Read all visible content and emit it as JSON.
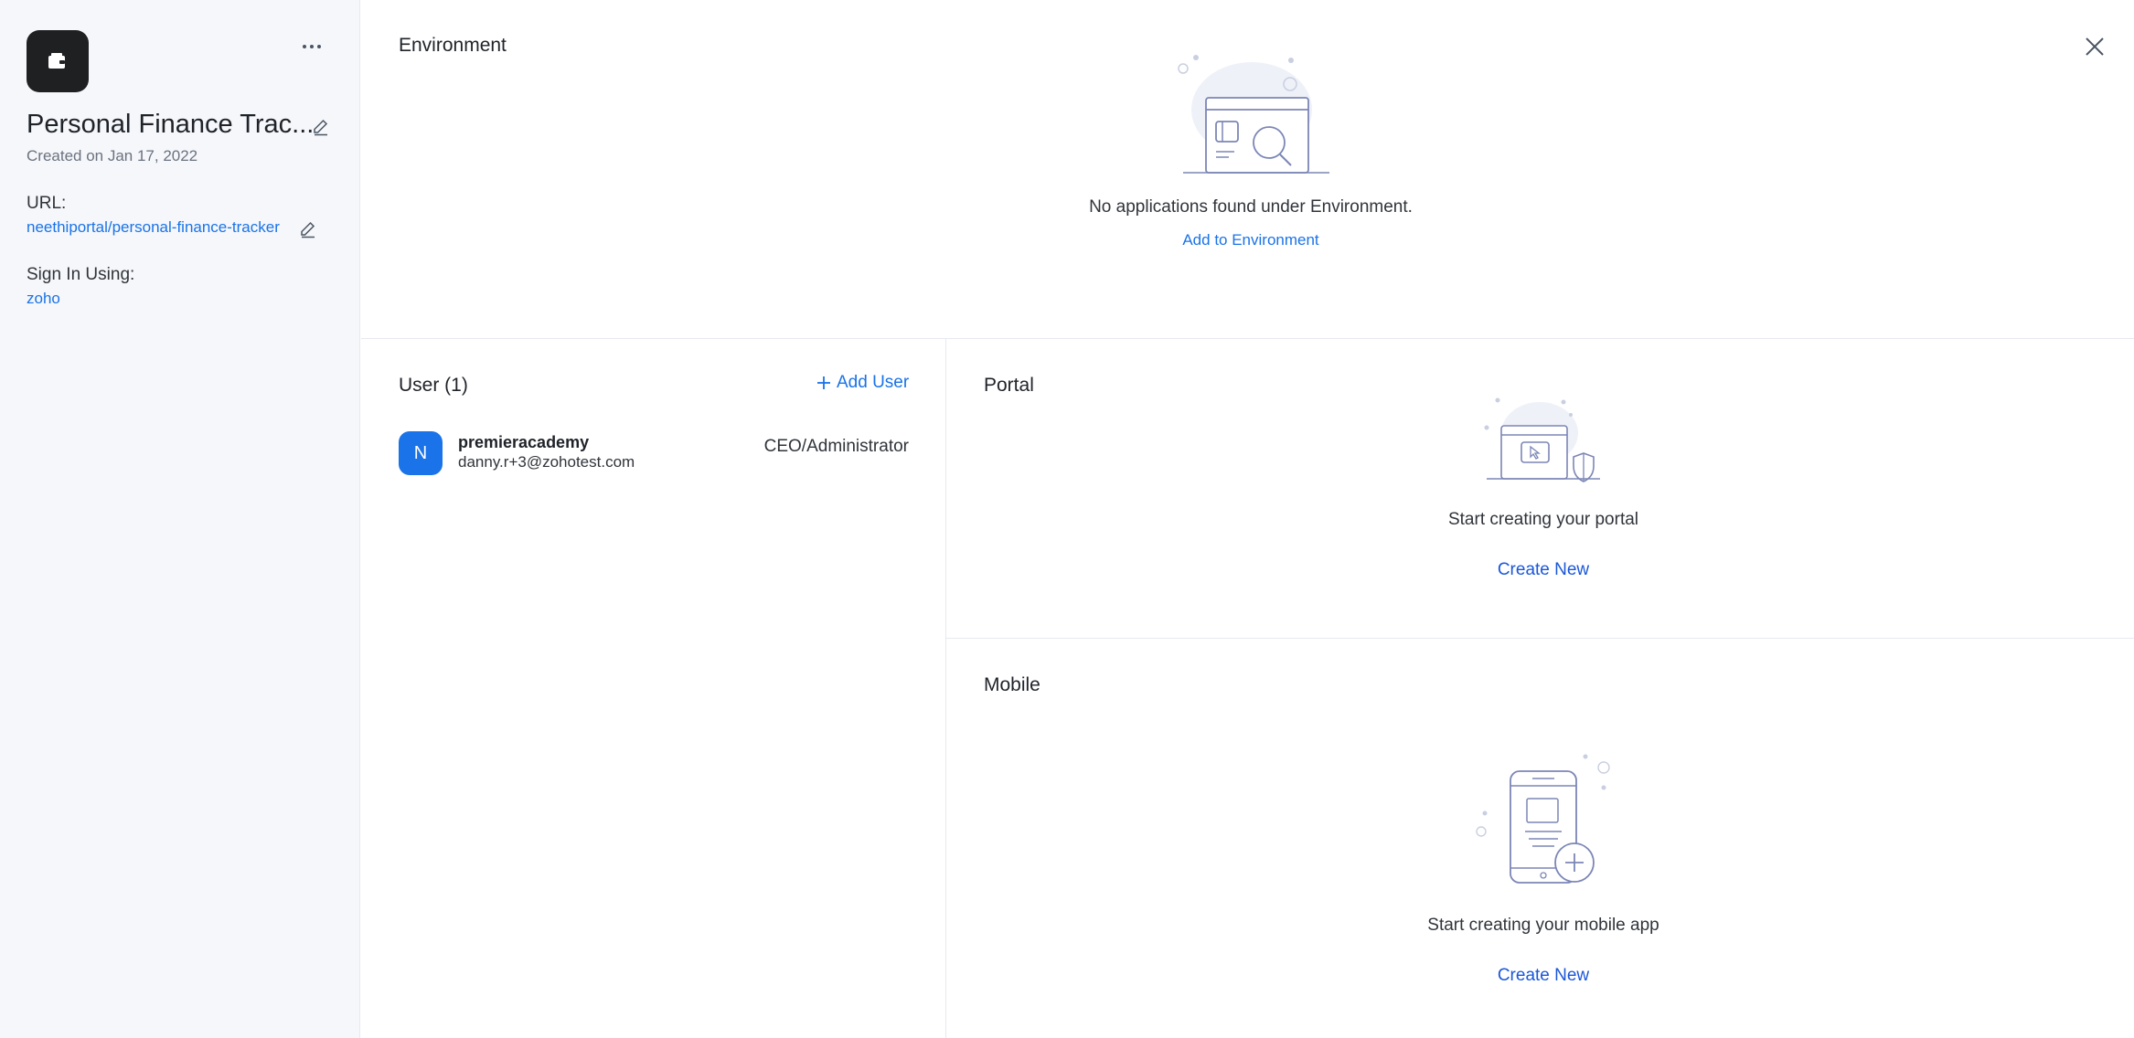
{
  "sidebar": {
    "app_title": "Personal Finance Trac...",
    "created": "Created on Jan 17, 2022",
    "url_label": "URL:",
    "url_value": "neethiportal/personal-finance-tracker",
    "signin_label": "Sign In Using:",
    "signin_value": "zoho"
  },
  "environment": {
    "title": "Environment",
    "message": "No applications found under Environment.",
    "action": "Add to Environment"
  },
  "users": {
    "title": "User (1)",
    "add_label": "Add User",
    "list": [
      {
        "initial": "N",
        "name": "premieracademy",
        "email": "danny.r+3@zohotest.com",
        "role": "CEO/Administrator"
      }
    ]
  },
  "portal": {
    "title": "Portal",
    "message": "Start creating your portal",
    "action": "Create New"
  },
  "mobile": {
    "title": "Mobile",
    "message": "Start creating your mobile app",
    "action": "Create New"
  },
  "icons": [
    "app-wallet-icon",
    "more-icon",
    "edit-icon",
    "close-icon",
    "plus-icon"
  ],
  "colors": {
    "accent": "#1a73e8",
    "sidebar_bg": "#f5f7fa",
    "avatar": "#1a73e8",
    "app_icon_bg": "#1f2022"
  }
}
